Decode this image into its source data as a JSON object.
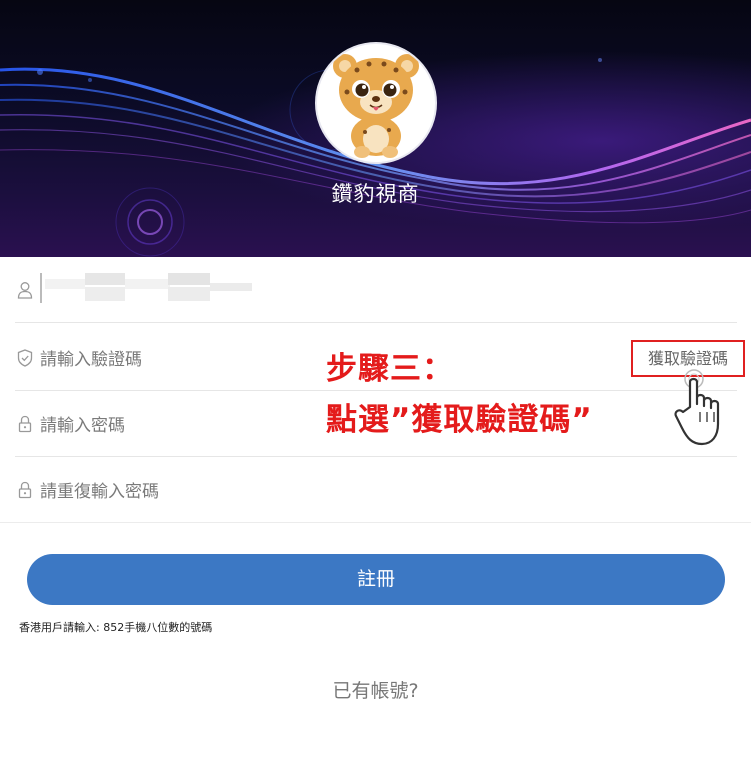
{
  "header": {
    "brand_name": "鑽豹視商",
    "avatar_icon": "leopard-mascot"
  },
  "form": {
    "phone": {
      "icon": "user-icon",
      "value": ""
    },
    "verification_code": {
      "icon": "shield-icon",
      "placeholder": "請輸入驗證碼"
    },
    "get_code_label": "獲取驗證碼",
    "password": {
      "icon": "lock-icon",
      "placeholder": "請輸入密碼"
    },
    "password_repeat": {
      "icon": "lock-icon",
      "placeholder": "請重復輸入密碼"
    },
    "register_label": "註冊",
    "hint": "香港用戶請輸入: 852手機八位數的號碼",
    "have_account": "已有帳號?"
  },
  "annotation": {
    "step_line1": "步驟三：",
    "step_line2": "點選”獲取驗證碼”",
    "color": "#e41b1b",
    "pointer_icon": "hand-pointer-icon"
  },
  "colors": {
    "primary": "#3c78c4",
    "highlight": "#e02020"
  }
}
